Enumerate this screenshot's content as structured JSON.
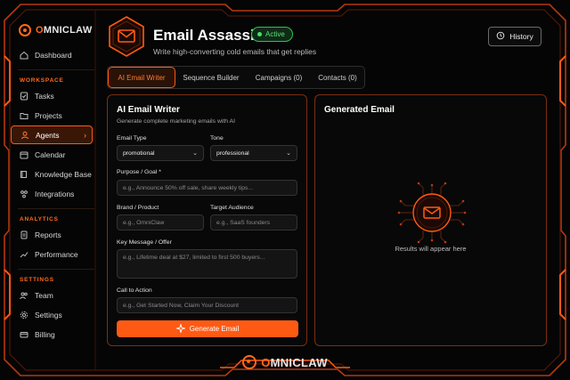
{
  "brand": {
    "logo_text_prefix": "O",
    "logo_text_rest": "MNICLAW",
    "accent": "#ff5a14"
  },
  "sidebar": {
    "dashboard": "Dashboard",
    "section_workspace": "WORKSPACE",
    "workspace_items": [
      {
        "label": "Tasks",
        "icon": "checklist-icon"
      },
      {
        "label": "Projects",
        "icon": "folder-icon"
      },
      {
        "label": "Agents",
        "icon": "user-icon",
        "active": true
      },
      {
        "label": "Calendar",
        "icon": "calendar-icon"
      },
      {
        "label": "Knowledge Base",
        "icon": "book-icon"
      },
      {
        "label": "Integrations",
        "icon": "plug-icon"
      }
    ],
    "section_analytics": "ANALYTICS",
    "analytics_items": [
      {
        "label": "Reports",
        "icon": "report-icon"
      },
      {
        "label": "Performance",
        "icon": "trend-icon"
      }
    ],
    "section_settings": "SETTINGS",
    "settings_items": [
      {
        "label": "Team",
        "icon": "team-icon"
      },
      {
        "label": "Settings",
        "icon": "gear-icon"
      },
      {
        "label": "Billing",
        "icon": "card-icon"
      }
    ]
  },
  "header": {
    "title": "Email Assassin",
    "status": "Active",
    "subtitle": "Write high-converting cold emails that get replies",
    "history_label": "History"
  },
  "tabs": [
    "AI Email Writer",
    "Sequence Builder",
    "Campaigns (0)",
    "Contacts (0)"
  ],
  "form": {
    "title": "AI Email Writer",
    "description": "Generate complete marketing emails with AI",
    "email_type_label": "Email Type",
    "email_type_value": "promotional",
    "tone_label": "Tone",
    "tone_value": "professional",
    "purpose_label": "Purpose / Goal *",
    "purpose_placeholder": "e.g., Announce 50% off sale, share weekly tips...",
    "brand_label": "Brand / Product",
    "brand_placeholder": "e.g., OmniClaw",
    "audience_label": "Target Audience",
    "audience_placeholder": "e.g., SaaS founders",
    "message_label": "Key Message / Offer",
    "message_placeholder": "e.g., Lifetime deal at $27, limited to first 500 buyers...",
    "cta_label": "Call to Action",
    "cta_placeholder": "e.g., Get Started Now, Claim Your Discount",
    "generate_label": "Generate Email"
  },
  "result": {
    "title": "Generated Email",
    "empty_text": "Results will appear here"
  }
}
